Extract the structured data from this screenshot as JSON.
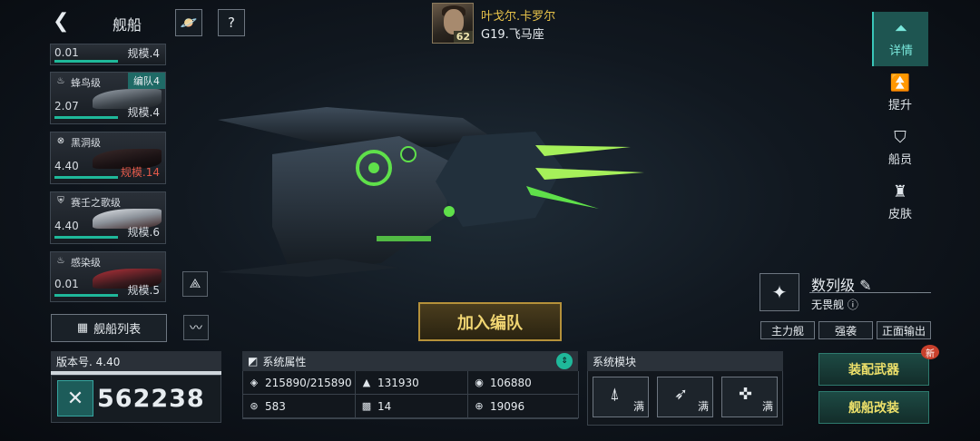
{
  "header": {
    "back_icon": "back-arrow-icon",
    "title": "舰船",
    "planet_icon": "planet-icon",
    "help_icon": "help-icon"
  },
  "player": {
    "name": "叶戈尔.卡罗尔",
    "server": "G19.飞马座",
    "level": "62"
  },
  "ships": [
    {
      "name": "",
      "value": "0.01",
      "scale": "规模.4",
      "scale_warn": false,
      "tag": ""
    },
    {
      "name": "蜂鸟级",
      "value": "2.07",
      "scale": "规模.4",
      "scale_warn": false,
      "tag": "编队4"
    },
    {
      "name": "黑洞级",
      "value": "4.40",
      "scale": "规模.14",
      "scale_warn": true,
      "tag": ""
    },
    {
      "name": "赛壬之歌级",
      "value": "4.40",
      "scale": "规模.6",
      "scale_warn": false,
      "tag": ""
    },
    {
      "name": "感染级",
      "value": "0.01",
      "scale": "规模.5",
      "scale_warn": false,
      "tag": ""
    }
  ],
  "list_button": "舰船列表",
  "version": {
    "label": "版本号. 4.40",
    "power": "562238"
  },
  "join_button": "加入编队",
  "attributes": {
    "title": "系统属性",
    "cells": [
      {
        "icon": "shield-icon",
        "value": "215890/215890"
      },
      {
        "icon": "armor-icon",
        "value": "131930"
      },
      {
        "icon": "energy-icon",
        "value": "106880"
      },
      {
        "icon": "speed-icon",
        "value": "583"
      },
      {
        "icon": "checker-icon",
        "value": "14"
      },
      {
        "icon": "target-icon",
        "value": "19096"
      }
    ]
  },
  "modules": {
    "title": "系统模块",
    "items": [
      {
        "icon": "ship-module-icon",
        "label": "满"
      },
      {
        "icon": "missile-module-icon",
        "label": "满"
      },
      {
        "icon": "cannon-module-icon",
        "label": "满"
      }
    ]
  },
  "right_tabs": [
    {
      "label": "详情",
      "active": true
    },
    {
      "label": "提升",
      "active": false
    },
    {
      "label": "船员",
      "active": false
    },
    {
      "label": "皮肤",
      "active": false
    }
  ],
  "ship_class": {
    "name": "数列级",
    "type": "无畏舰",
    "tags": [
      "主力舰",
      "强袭",
      "正面输出"
    ]
  },
  "buttons": {
    "equip": "装配武器",
    "refit": "舰船改装",
    "new_badge": "新"
  },
  "colors": {
    "accent": "#1fb89a",
    "gold": "#e6c24a",
    "warn": "#e35a4a"
  }
}
